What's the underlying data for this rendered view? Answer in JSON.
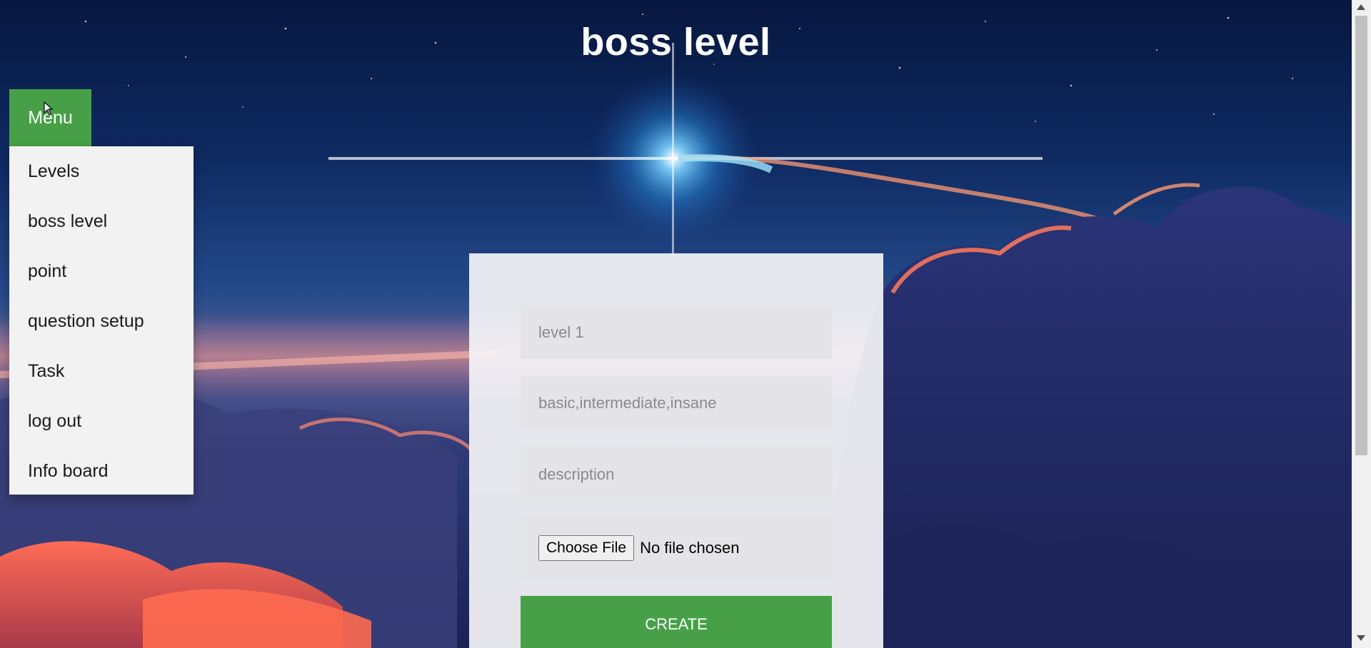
{
  "page": {
    "title": "boss level"
  },
  "menu": {
    "button_label": "Menu",
    "items": [
      {
        "label": "Levels"
      },
      {
        "label": "boss level"
      },
      {
        "label": "point"
      },
      {
        "label": "question setup"
      },
      {
        "label": "Task"
      },
      {
        "label": "log out"
      },
      {
        "label": "Info board"
      }
    ]
  },
  "form": {
    "level_placeholder": "level 1",
    "difficulty_placeholder": "basic,intermediate,insane",
    "description_placeholder": "description",
    "file_button_label": "Choose File",
    "file_status": "No file chosen",
    "submit_label": "CREATE"
  },
  "colors": {
    "accent_green": "#47a047",
    "panel_bg": "#f4f3f6",
    "field_bg": "#e4e3e6",
    "dropdown_bg": "#f2f2f2"
  },
  "icons": {
    "cursor": "mouse-pointer-icon"
  }
}
